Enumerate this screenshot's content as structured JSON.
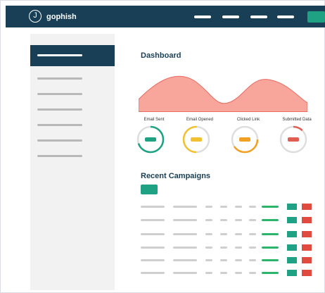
{
  "app": {
    "brand": "gophish",
    "logo_letter": "J"
  },
  "main": {
    "dashboard_title": "Dashboard",
    "stats": [
      {
        "label": "Email Sent",
        "color": "#1fa284",
        "fraction": 0.7
      },
      {
        "label": "Email Opened",
        "color": "#f2c131",
        "fraction": 0.5
      },
      {
        "label": "Clicked Link",
        "color": "#f2a024",
        "fraction": 0.4
      },
      {
        "label": "Submitted Data",
        "color": "#e05d52",
        "fraction": 0.12
      }
    ],
    "recent_title": "Recent Campaigns"
  },
  "colors": {
    "navy": "#183f55",
    "teal": "#1fa284",
    "red": "#e04a3f",
    "green": "#2ab56b",
    "chart_fill": "#f8a59b",
    "chart_stroke": "#e86c62"
  }
}
